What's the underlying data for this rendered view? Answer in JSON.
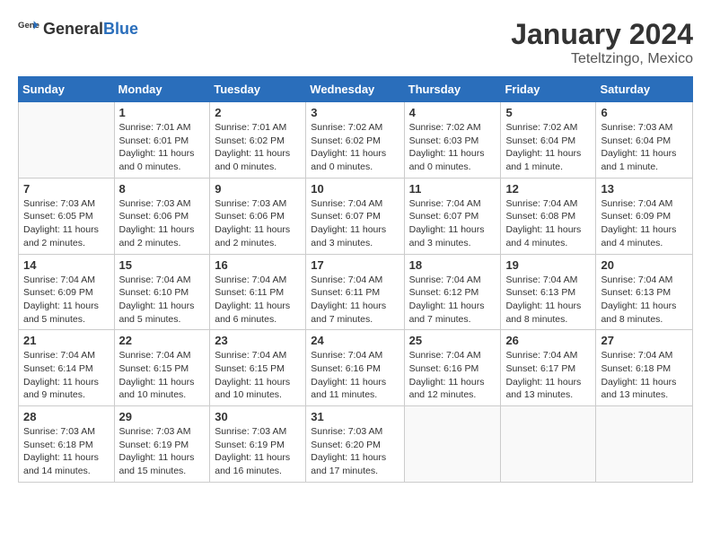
{
  "logo": {
    "general": "General",
    "blue": "Blue"
  },
  "title": "January 2024",
  "subtitle": "Teteltzingo, Mexico",
  "days_header": [
    "Sunday",
    "Monday",
    "Tuesday",
    "Wednesday",
    "Thursday",
    "Friday",
    "Saturday"
  ],
  "weeks": [
    [
      {
        "num": "",
        "info": ""
      },
      {
        "num": "1",
        "info": "Sunrise: 7:01 AM\nSunset: 6:01 PM\nDaylight: 11 hours\nand 0 minutes."
      },
      {
        "num": "2",
        "info": "Sunrise: 7:01 AM\nSunset: 6:02 PM\nDaylight: 11 hours\nand 0 minutes."
      },
      {
        "num": "3",
        "info": "Sunrise: 7:02 AM\nSunset: 6:02 PM\nDaylight: 11 hours\nand 0 minutes."
      },
      {
        "num": "4",
        "info": "Sunrise: 7:02 AM\nSunset: 6:03 PM\nDaylight: 11 hours\nand 0 minutes."
      },
      {
        "num": "5",
        "info": "Sunrise: 7:02 AM\nSunset: 6:04 PM\nDaylight: 11 hours\nand 1 minute."
      },
      {
        "num": "6",
        "info": "Sunrise: 7:03 AM\nSunset: 6:04 PM\nDaylight: 11 hours\nand 1 minute."
      }
    ],
    [
      {
        "num": "7",
        "info": "Sunrise: 7:03 AM\nSunset: 6:05 PM\nDaylight: 11 hours\nand 2 minutes."
      },
      {
        "num": "8",
        "info": "Sunrise: 7:03 AM\nSunset: 6:06 PM\nDaylight: 11 hours\nand 2 minutes."
      },
      {
        "num": "9",
        "info": "Sunrise: 7:03 AM\nSunset: 6:06 PM\nDaylight: 11 hours\nand 2 minutes."
      },
      {
        "num": "10",
        "info": "Sunrise: 7:04 AM\nSunset: 6:07 PM\nDaylight: 11 hours\nand 3 minutes."
      },
      {
        "num": "11",
        "info": "Sunrise: 7:04 AM\nSunset: 6:07 PM\nDaylight: 11 hours\nand 3 minutes."
      },
      {
        "num": "12",
        "info": "Sunrise: 7:04 AM\nSunset: 6:08 PM\nDaylight: 11 hours\nand 4 minutes."
      },
      {
        "num": "13",
        "info": "Sunrise: 7:04 AM\nSunset: 6:09 PM\nDaylight: 11 hours\nand 4 minutes."
      }
    ],
    [
      {
        "num": "14",
        "info": "Sunrise: 7:04 AM\nSunset: 6:09 PM\nDaylight: 11 hours\nand 5 minutes."
      },
      {
        "num": "15",
        "info": "Sunrise: 7:04 AM\nSunset: 6:10 PM\nDaylight: 11 hours\nand 5 minutes."
      },
      {
        "num": "16",
        "info": "Sunrise: 7:04 AM\nSunset: 6:11 PM\nDaylight: 11 hours\nand 6 minutes."
      },
      {
        "num": "17",
        "info": "Sunrise: 7:04 AM\nSunset: 6:11 PM\nDaylight: 11 hours\nand 7 minutes."
      },
      {
        "num": "18",
        "info": "Sunrise: 7:04 AM\nSunset: 6:12 PM\nDaylight: 11 hours\nand 7 minutes."
      },
      {
        "num": "19",
        "info": "Sunrise: 7:04 AM\nSunset: 6:13 PM\nDaylight: 11 hours\nand 8 minutes."
      },
      {
        "num": "20",
        "info": "Sunrise: 7:04 AM\nSunset: 6:13 PM\nDaylight: 11 hours\nand 8 minutes."
      }
    ],
    [
      {
        "num": "21",
        "info": "Sunrise: 7:04 AM\nSunset: 6:14 PM\nDaylight: 11 hours\nand 9 minutes."
      },
      {
        "num": "22",
        "info": "Sunrise: 7:04 AM\nSunset: 6:15 PM\nDaylight: 11 hours\nand 10 minutes."
      },
      {
        "num": "23",
        "info": "Sunrise: 7:04 AM\nSunset: 6:15 PM\nDaylight: 11 hours\nand 10 minutes."
      },
      {
        "num": "24",
        "info": "Sunrise: 7:04 AM\nSunset: 6:16 PM\nDaylight: 11 hours\nand 11 minutes."
      },
      {
        "num": "25",
        "info": "Sunrise: 7:04 AM\nSunset: 6:16 PM\nDaylight: 11 hours\nand 12 minutes."
      },
      {
        "num": "26",
        "info": "Sunrise: 7:04 AM\nSunset: 6:17 PM\nDaylight: 11 hours\nand 13 minutes."
      },
      {
        "num": "27",
        "info": "Sunrise: 7:04 AM\nSunset: 6:18 PM\nDaylight: 11 hours\nand 13 minutes."
      }
    ],
    [
      {
        "num": "28",
        "info": "Sunrise: 7:03 AM\nSunset: 6:18 PM\nDaylight: 11 hours\nand 14 minutes."
      },
      {
        "num": "29",
        "info": "Sunrise: 7:03 AM\nSunset: 6:19 PM\nDaylight: 11 hours\nand 15 minutes."
      },
      {
        "num": "30",
        "info": "Sunrise: 7:03 AM\nSunset: 6:19 PM\nDaylight: 11 hours\nand 16 minutes."
      },
      {
        "num": "31",
        "info": "Sunrise: 7:03 AM\nSunset: 6:20 PM\nDaylight: 11 hours\nand 17 minutes."
      },
      {
        "num": "",
        "info": ""
      },
      {
        "num": "",
        "info": ""
      },
      {
        "num": "",
        "info": ""
      }
    ]
  ]
}
